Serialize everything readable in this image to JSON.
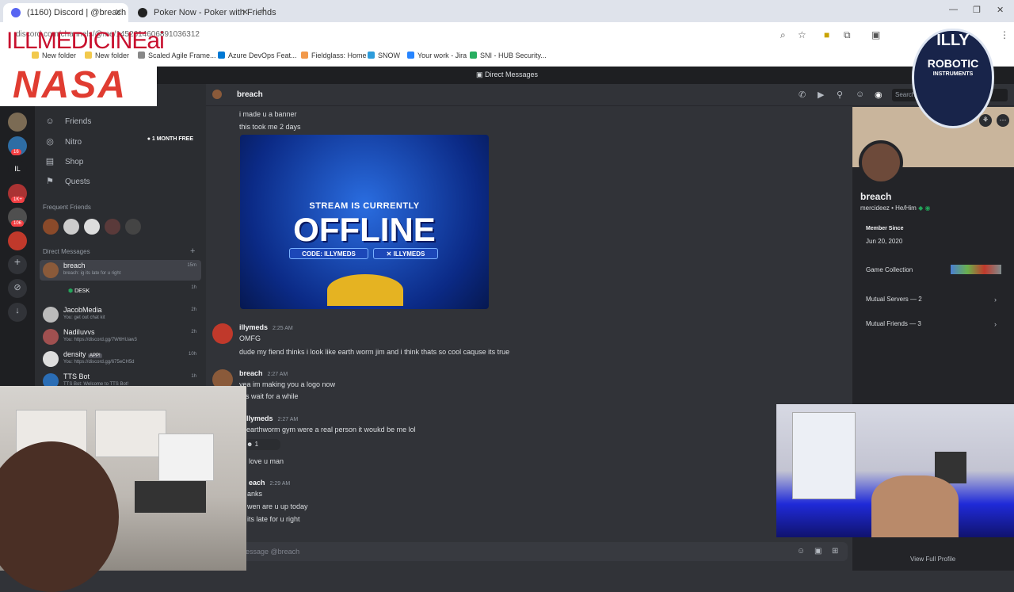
{
  "browser": {
    "tabs": [
      {
        "title": "(1160) Discord | @breach",
        "active": true
      },
      {
        "title": "Poker Now - Poker with Friends",
        "active": false
      }
    ],
    "url": "discord.com/channels/@me/1452614606891036312",
    "bookmarks": [
      "New folder",
      "New folder",
      "Scaled Agile Frame...",
      "Azure DevOps Feat...",
      "Fieldglass: Home",
      "SNOW",
      "Your work - Jira",
      "SNI - HUB Security..."
    ]
  },
  "discord": {
    "window_title": "Direct Messages",
    "nav": {
      "friends": "Friends",
      "nitro": "Nitro",
      "nitro_badge": "1 MONTH FREE",
      "shop": "Shop",
      "quests": "Quests"
    },
    "frequent_friends_label": "Frequent Friends",
    "direct_messages_label": "Direct Messages",
    "dms": [
      {
        "name": "breach",
        "sub": "breach: ig its late for u right",
        "time": "15m",
        "selected": true
      },
      {
        "name": "DESK",
        "sub": "",
        "time": "1h",
        "selected": false
      },
      {
        "name": "JacobMedia",
        "sub": "You: get out chat kit",
        "time": "2h",
        "selected": false
      },
      {
        "name": "NadiIuvvs",
        "sub": "You: https://discord.gg/7W6HUaw3",
        "time": "2h",
        "selected": false
      },
      {
        "name": "density",
        "badge": "APP!",
        "sub": "You: https://discord.gg/675eCH5d",
        "time": "10h",
        "selected": false
      },
      {
        "name": "TTS Bot",
        "sub": "TTS Bot: Welcome to TTS Bot!",
        "time": "1h",
        "selected": false
      }
    ],
    "guild_badges": [
      "16",
      "IL",
      "1K+",
      "106"
    ],
    "chat": {
      "recipient": "breach",
      "search_placeholder": "Search",
      "messages": [
        {
          "line": "i made u a banner"
        },
        {
          "line": "this took me 2 days"
        },
        {
          "author": "illymeds",
          "time": "2:25 AM",
          "line": "OMFG"
        },
        {
          "line": "dude my fiend thinks i look like earth worm jim and i think thats so cool caquse its true"
        },
        {
          "author": "breach",
          "time": "2:27 AM",
          "line": "yea im making you a logo now"
        },
        {
          "line": "s wait for a while"
        },
        {
          "author": "llymeds",
          "time": "2:27 AM",
          "line": "earthworm gym were a real person it woukd be me lol"
        },
        {
          "line": "love u man"
        },
        {
          "author": "each",
          "time": "2:29 AM",
          "line": "anks"
        },
        {
          "line": "wen are u up today"
        },
        {
          "line": "its late for u right"
        }
      ],
      "reaction_count": "1",
      "composer_placeholder": "essage @breach"
    },
    "banner_image": {
      "line1": "STREAM IS CURRENTLY",
      "line2": "OFFLINE",
      "code": "CODE: ILLYMEDS",
      "handle": "ILLYMEDS"
    },
    "profile": {
      "name": "breach",
      "tagline": "mercideez • He/Him",
      "member_since_label": "Member Since",
      "member_since": "Jun 20, 2020",
      "game_collection": "Game Collection",
      "mutual_servers": "Mutual Servers — 2",
      "mutual_friends": "Mutual Friends — 3",
      "view_full": "View Full Profile"
    }
  },
  "overlays": {
    "watermark": "ILLMEDICINEai",
    "nasa": "NASA",
    "illy_line1": "ILLY",
    "illy_line2": "ROBOTIC",
    "illy_line3": "INSTRUMENTS"
  }
}
